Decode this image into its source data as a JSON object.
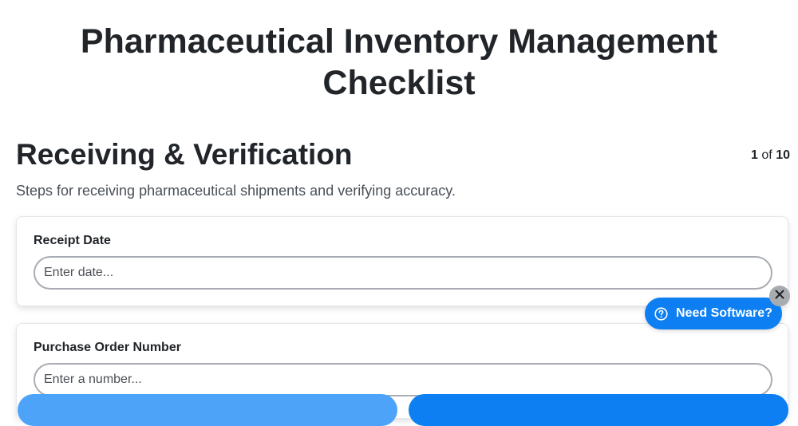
{
  "page": {
    "title": "Pharmaceutical Inventory Management Checklist"
  },
  "section": {
    "title": "Receiving & Verification",
    "description": "Steps for receiving pharmaceutical shipments and verifying accuracy.",
    "step_current": "1",
    "step_of": "of",
    "step_total": "10"
  },
  "fields": [
    {
      "label": "Receipt Date",
      "value": "",
      "placeholder": "Enter date..."
    },
    {
      "label": "Purchase Order Number",
      "value": "",
      "placeholder": "Enter a number..."
    }
  ],
  "promo": {
    "label": "Need Software?",
    "icon": "question-circle-icon",
    "close_icon": "close-icon",
    "color": "#0d7ff2"
  },
  "colors": {
    "primary": "#0d7ff2",
    "primary_light": "#4da3f7",
    "text": "#212529",
    "muted": "#495057"
  }
}
